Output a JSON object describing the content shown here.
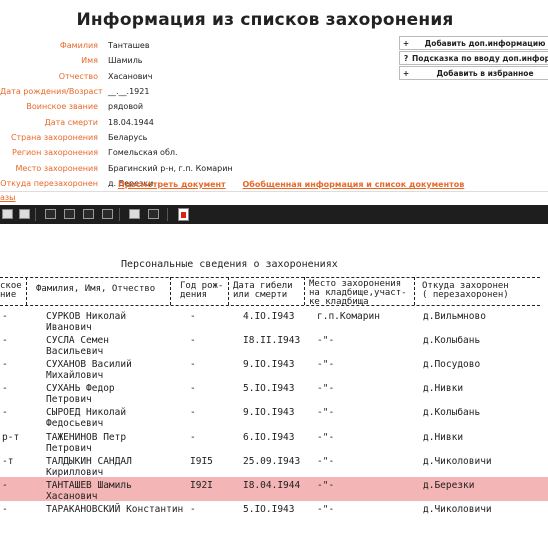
{
  "page_title": "Информация из списков захоронения",
  "fields": [
    {
      "label": "Фамилия",
      "value": "Танташев"
    },
    {
      "label": "Имя",
      "value": "Шамиль"
    },
    {
      "label": "Отчество",
      "value": "Хасанович"
    },
    {
      "label": "Дата рождения/Возраст",
      "value": "__.__.1921"
    },
    {
      "label": "Воинское звание",
      "value": "рядовой"
    },
    {
      "label": "Дата смерти",
      "value": "18.04.1944"
    },
    {
      "label": "Страна захоронения",
      "value": "Беларусь"
    },
    {
      "label": "Регион захоронения",
      "value": "Гомельская обл."
    },
    {
      "label": "Место захоронения",
      "value": "Брагинский р-н, г.п. Комарин"
    },
    {
      "label": "Откуда перезахоронен",
      "value": "д. Березки"
    }
  ],
  "side_buttons": [
    {
      "icon": "+",
      "label": "Добавить доп.информацию"
    },
    {
      "icon": "?",
      "label": "Подсказка по вводу доп.информа"
    },
    {
      "icon": "+",
      "label": "Добавить в избранное"
    }
  ],
  "links": {
    "view_document": "Просмотреть документ",
    "summary": "Обобщенная информация и список документов"
  },
  "back_link": "азы",
  "document": {
    "title": "Персональные сведения о захоронениях",
    "headers": {
      "col0": "ское\nние",
      "name": "Фамилия, Имя, Отчество",
      "year": "Год рож-\nдения",
      "date": "Дата гибели\nили смерти",
      "place": "Место захоронения\nна кладбище,участ-\nке кладбища",
      "from": "Откуда захоронен\n( перезахоронен)"
    },
    "rows": [
      {
        "c0": "-",
        "name1": "СУРКОВ Николай",
        "name2": "Иванович",
        "year": "-",
        "date": "4.IO.I943",
        "place": "г.п.Комарин",
        "from": "д.Вильмново",
        "highlight": false
      },
      {
        "c0": "-",
        "name1": "СУСЛА Семен",
        "name2": "Васильевич",
        "year": "-",
        "date": "I8.II.I943",
        "place": "-\"-",
        "from": "д.Колыбань",
        "highlight": false
      },
      {
        "c0": "-",
        "name1": "СУХАНОВ Василий",
        "name2": "Михайлович",
        "year": "-",
        "date": "9.IO.I943",
        "place": "-\"-",
        "from": "д.Посудово",
        "highlight": false
      },
      {
        "c0": "-",
        "name1": "СУХАНЬ Федор",
        "name2": "Петрович",
        "year": "-",
        "date": "5.IO.I943",
        "place": "-\"-",
        "from": "д.Нивки",
        "highlight": false
      },
      {
        "c0": "-",
        "name1": "СЫРОЕД Николай",
        "name2": "Федосьевич",
        "year": "-",
        "date": "9.IO.I943",
        "place": "-\"-",
        "from": "д.Колыбань",
        "highlight": false
      },
      {
        "c0": "р-т",
        "name1": "ТАЖЕНИНОВ Петр",
        "name2": "Петрович",
        "year": "-",
        "date": "6.IO.I943",
        "place": "-\"-",
        "from": "д.Нивки",
        "highlight": false
      },
      {
        "c0": "-т",
        "name1": "ТАЛДЫКИН САНДАЛ",
        "name2": "Кириллович",
        "year": "I9I5",
        "date": "25.09.I943",
        "place": "-\"-",
        "from": "д.Чиколовичи",
        "highlight": false
      },
      {
        "c0": "-",
        "name1": "ТАНТАШЕВ Шамиль",
        "name2": "Хасанович",
        "year": "I92I",
        "date": "I8.04.I944",
        "place": "-\"-",
        "from": "д.Березки",
        "highlight": true
      },
      {
        "c0": "-",
        "name1": "ТАРАКАНОВСКИЙ Константин",
        "name2": "",
        "year": "-",
        "date": "5.IO.I943",
        "place": "-\"-",
        "from": "д.Чиколовичи",
        "highlight": false
      }
    ]
  },
  "colors": {
    "accent": "#e8692a",
    "toolbar": "#1e1e1e",
    "highlight": "#f3b5b5"
  }
}
